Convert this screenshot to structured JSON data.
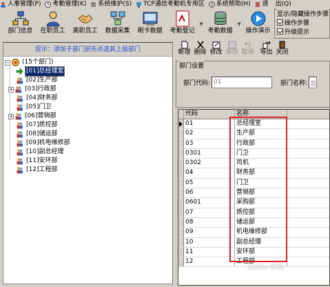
{
  "menubar": {
    "items": [
      {
        "label": "人事管理(P)",
        "icon": "people-icon"
      },
      {
        "label": "考勤管理(K)",
        "icon": "clock-icon"
      },
      {
        "label": "系统维护(S)",
        "icon": "tools-icon"
      },
      {
        "label": "TCP通信考勤机专用区",
        "icon": "network-icon"
      },
      {
        "label": "系统帮助(H)",
        "icon": "help-icon"
      },
      {
        "label": "退",
        "icon": "exit-icon"
      },
      {
        "label": "出(Q)",
        "icon": ""
      }
    ]
  },
  "toolbar": {
    "buttons": [
      {
        "label": "部门信息",
        "icon": "org-chart-icon"
      },
      {
        "label": "在职员工",
        "icon": "employee-icon"
      },
      {
        "label": "离职员工",
        "icon": "handshake-icon"
      },
      {
        "label": "数据采集",
        "icon": "computer-network-icon"
      },
      {
        "label": "刷卡数据",
        "icon": "card-data-icon"
      },
      {
        "label": "考勤登记",
        "icon": "register-icon"
      },
      {
        "label": "考勤数据",
        "icon": "database-icon"
      },
      {
        "label": "操作演示",
        "icon": "play-demo-icon"
      }
    ]
  },
  "options": {
    "legend": "显示/隐藏操作步骤",
    "items": [
      {
        "label": "操作步骤",
        "checked": true
      },
      {
        "label": "升级提示",
        "checked": true
      }
    ]
  },
  "left": {
    "hint": "提示：添加子部门前先点选其上级部门",
    "root": "(15个部门)",
    "nodes": [
      {
        "label": "[01]总经理室",
        "selected": true,
        "expander": ""
      },
      {
        "label": "[02]生产部",
        "expander": ""
      },
      {
        "label": "[03]行政部",
        "expander": "+"
      },
      {
        "label": "[04]财务部",
        "expander": ""
      },
      {
        "label": "[05]门卫",
        "expander": ""
      },
      {
        "label": "[06]营销部",
        "expander": "+"
      },
      {
        "label": "[07]质控部",
        "expander": ""
      },
      {
        "label": "[08]储运部",
        "expander": ""
      },
      {
        "label": "[09]机电维修部",
        "expander": ""
      },
      {
        "label": "[10]副总经理",
        "expander": ""
      },
      {
        "label": "[11]安环部",
        "expander": ""
      },
      {
        "label": "[12]工程部",
        "expander": ""
      }
    ]
  },
  "right": {
    "toolbar": [
      {
        "label": "新增",
        "icon": "new-doc-icon",
        "enabled": true
      },
      {
        "label": "删除",
        "icon": "delete-x-icon",
        "enabled": true
      },
      {
        "label": "修改",
        "icon": "edit-icon",
        "enabled": true
      },
      {
        "label": "保存",
        "icon": "save-icon",
        "enabled": false
      },
      {
        "label": "取消",
        "icon": "undo-icon",
        "enabled": false
      },
      {
        "label": "导出",
        "icon": "export-icon",
        "enabled": true
      },
      {
        "label": "关闭",
        "icon": "close-door-icon",
        "enabled": true
      }
    ],
    "group": "部门设置",
    "code_label": "部门代码:",
    "code_value": "01",
    "name_label": "部门名称:",
    "name_value": "总",
    "grid": {
      "headers": [
        "代码",
        "名称"
      ],
      "rows": [
        [
          "01",
          "总经理室"
        ],
        [
          "02",
          "生产部"
        ],
        [
          "03",
          "行政部"
        ],
        [
          "0301",
          "门卫"
        ],
        [
          "0302",
          "司机"
        ],
        [
          "04",
          "财务部"
        ],
        [
          "05",
          "门卫"
        ],
        [
          "06",
          "营销部"
        ],
        [
          "0601",
          "采购部"
        ],
        [
          "07",
          "质控部"
        ],
        [
          "08",
          "储运部"
        ],
        [
          "09",
          "机电维修部"
        ],
        [
          "10",
          "副总经理"
        ],
        [
          "11",
          "安环部"
        ],
        [
          "12",
          "工程部"
        ]
      ]
    }
  },
  "watermark": "Baidu 经验",
  "colors": {
    "highlight": "#e02020",
    "hint": "#1f4fd1",
    "selection": "#0a246a"
  }
}
